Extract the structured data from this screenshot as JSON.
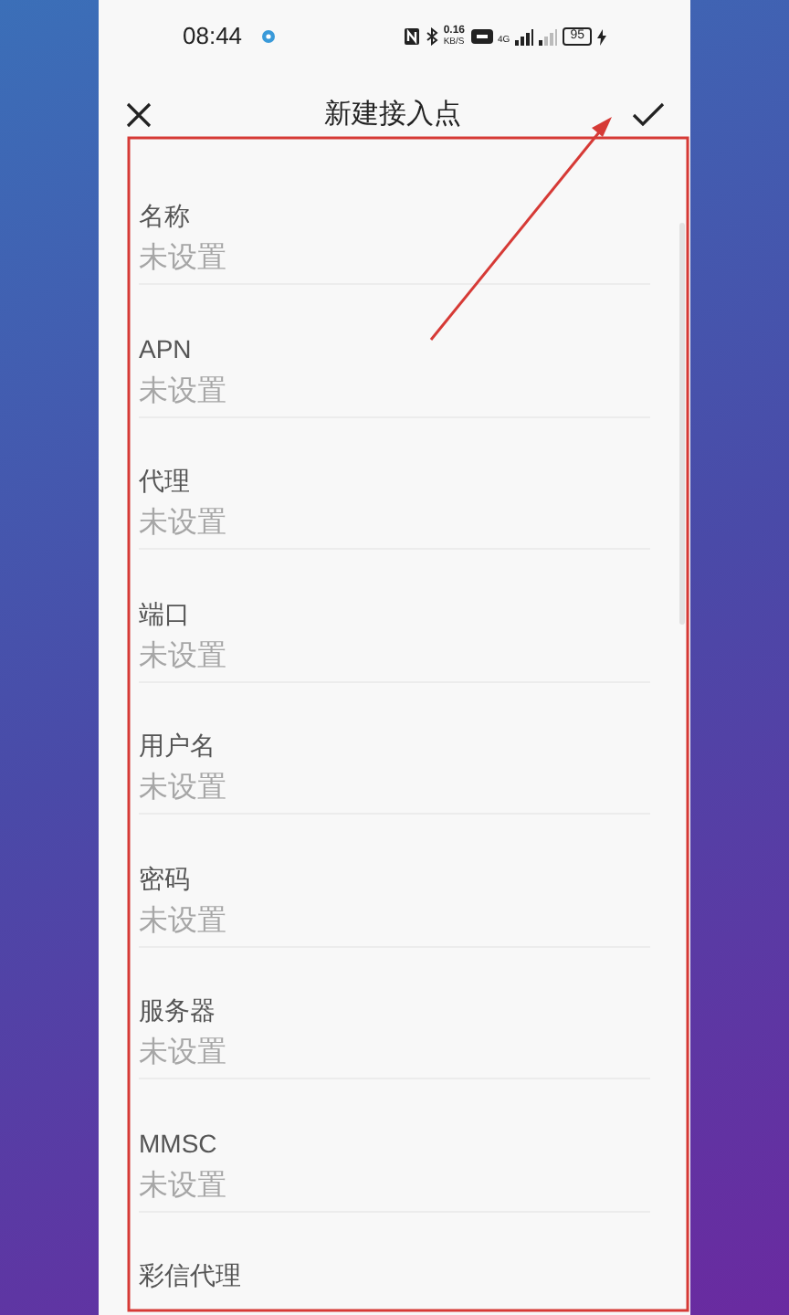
{
  "status_bar": {
    "time": "08:44",
    "speed": "0.16",
    "speed_unit": "KB/S",
    "network": "4G",
    "battery": "95"
  },
  "header": {
    "title": "新建接入点"
  },
  "fields": [
    {
      "label": "名称",
      "value": "未设置"
    },
    {
      "label": "APN",
      "value": "未设置"
    },
    {
      "label": "代理",
      "value": "未设置"
    },
    {
      "label": "端口",
      "value": "未设置"
    },
    {
      "label": "用户名",
      "value": "未设置"
    },
    {
      "label": "密码",
      "value": "未设置"
    },
    {
      "label": "服务器",
      "value": "未设置"
    },
    {
      "label": "MMSC",
      "value": "未设置"
    },
    {
      "label": "彩信代理"
    }
  ]
}
